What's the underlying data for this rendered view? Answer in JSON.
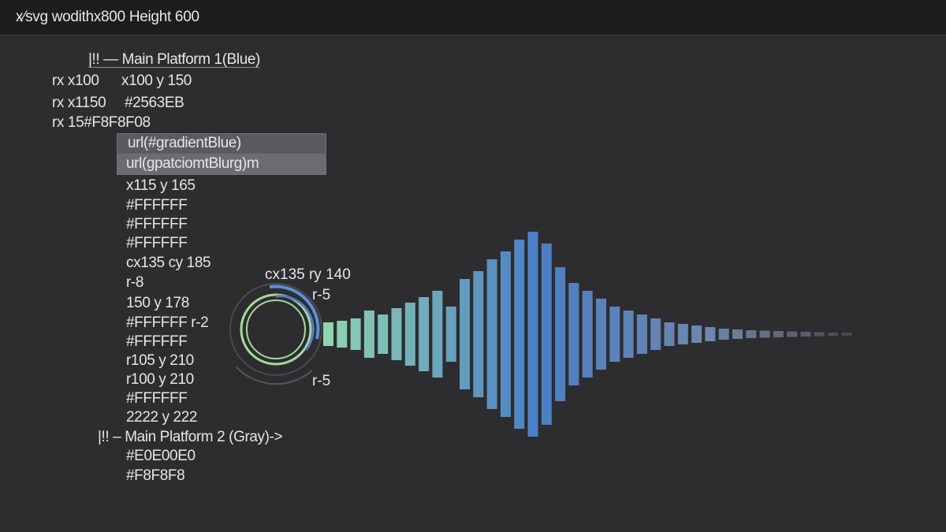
{
  "topbar": {
    "title": "x⁄svg wodithx800 Height 600"
  },
  "lines": {
    "main_platform_1": "|!! — Main Platform 1(Blue)",
    "rx_row1_a": "rx  x100",
    "rx_row1_b": "x100 y 150",
    "rx_row2_a": "rx  x1150",
    "rx_row2_b": "#2563EB",
    "rx_row3": "rx  15#F8F8F08",
    "url_gradient": "url(#gradientBlue)",
    "url_pattern": "url(gpatciomtBlurg)m",
    "x115": "x115 y 165",
    "ffffff_1": "#FFFFFF",
    "ffffff_2": "#FFFFFF",
    "ffffff_3": "#FFFFFF",
    "cx135_cy185": "cx135 cy 185",
    "r8": "r-8",
    "y178": "150 y 178",
    "ffffff_r2": "#FFFFFF  r-2",
    "ffffff_4": "#FFFFFF",
    "r105": "r105 y 210",
    "r100": "r100 y 210",
    "ffffff_5": "#FFFFFF",
    "y222": "2222 y 222",
    "main_platform_2": "|!! – Main Platform 2 (Gray)->",
    "e0e0e0": "#E0E00E0",
    "f8f8f8": "#F8F8F8"
  },
  "annotations": {
    "cx135_cy140": "cx135 ry 140",
    "r5_top": "r-5",
    "r5_bottom": "r-5"
  },
  "colors": {
    "background": "#2d2d2f",
    "topbar": "#1d1d1f",
    "bar_start": "#8fd3b0",
    "bar_mid": "#4b7fc6",
    "bar_end": "#8a8d97",
    "ring_green": "#a8d8a0",
    "ring_blue": "#5b8fd8"
  },
  "icons": {
    "visualizer": "audio-waveform-icon"
  }
}
